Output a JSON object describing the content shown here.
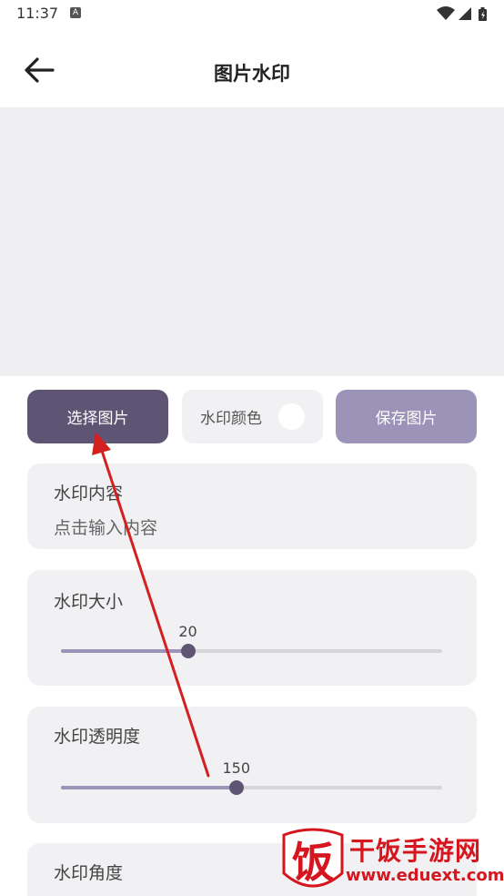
{
  "status_bar": {
    "time": "11:37",
    "notification_icon": "A",
    "icons": [
      "wifi-icon",
      "signal-icon",
      "battery-icon"
    ]
  },
  "header": {
    "title": "图片水印",
    "back_icon": "arrow-left-icon"
  },
  "actions": {
    "select_image_label": "选择图片",
    "watermark_color_label": "水印颜色",
    "watermark_color_value": "#ffffff",
    "save_image_label": "保存图片"
  },
  "watermark_content": {
    "label": "水印内容",
    "placeholder": "点击输入内容"
  },
  "watermark_size": {
    "label": "水印大小",
    "value": "20",
    "fraction": 0.333
  },
  "watermark_opacity": {
    "label": "水印透明度",
    "value": "150",
    "fraction": 0.46
  },
  "watermark_angle": {
    "label": "水印角度"
  },
  "site_watermark": {
    "logo_char": "饭",
    "title": "干饭手游网",
    "url": "www.eduext.com"
  },
  "colors": {
    "primary": "#5e5574",
    "accent": "#9c93b8",
    "card_bg": "#f1f0f3",
    "annotation_arrow": "#d32020",
    "site_red": "#d5161e"
  }
}
